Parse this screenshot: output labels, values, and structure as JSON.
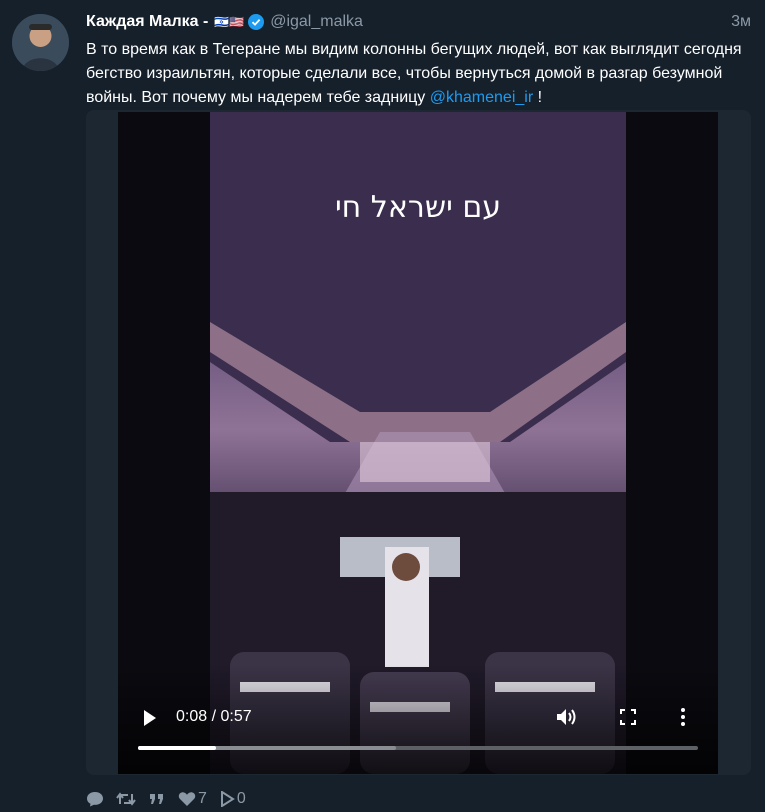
{
  "tweet": {
    "author_name": "Каждая Малка -",
    "author_flags": "🇮🇱🇺🇸",
    "handle": "@igal_malka",
    "time": "3м",
    "text_main": "В то время как в Тегеране мы видим колонны бегущих людей, вот как выглядит сегодня бегство израильтян, которые сделали все, чтобы вернуться домой в разгар безумной войны. Вот почему мы надерем тебе задницу ",
    "mention": "@khamenei_ir",
    "text_end": " !"
  },
  "video": {
    "overlay_text": "עם ישראל חי",
    "timecode": "0:08 / 0:57",
    "progress_fraction": 0.14
  },
  "actions": {
    "likes": "7",
    "views": "0"
  },
  "icons": {
    "play": "play-icon",
    "volume": "volume-icon",
    "fullscreen": "fullscreen-icon",
    "more": "more-vertical-icon",
    "reply": "reply-icon",
    "retweet": "retweet-icon",
    "quote": "quote-icon",
    "like": "heart-icon",
    "view": "views-icon"
  },
  "colors": {
    "background": "#15202b",
    "accent": "#1d9bf0",
    "muted": "#8b98a5"
  }
}
